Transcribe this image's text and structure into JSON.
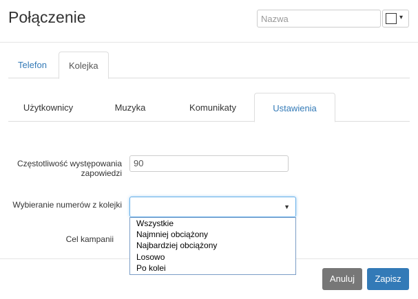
{
  "header": {
    "title": "Połączenie",
    "name_placeholder": "Nazwa",
    "color_caret": "▾"
  },
  "tabs_primary": [
    {
      "label": "Telefon",
      "active": false
    },
    {
      "label": "Kolejka",
      "active": true
    }
  ],
  "tabs_secondary": [
    {
      "label": "Użytkownicy",
      "active": false
    },
    {
      "label": "Muzyka",
      "active": false
    },
    {
      "label": "Komunikaty",
      "active": false
    },
    {
      "label": "Ustawienia",
      "active": true
    }
  ],
  "form": {
    "frequency_label_line1": "Częstotliwość występowania",
    "frequency_label_line2": "zapowiedzi",
    "frequency_value": "90",
    "dial_label": "Wybieranie numerów z kolejki",
    "dial_caret": "▼",
    "dial_selected": "",
    "dial_options": [
      "Wszystkie",
      "Najmniej obciążony",
      "Najbardziej obciążony",
      "Losowo",
      "Po kolei"
    ],
    "campaign_label": "Cel kampanii"
  },
  "footer": {
    "cancel_label": "Anuluj",
    "save_label": "Zapisz"
  },
  "colors": {
    "primary": "#337ab7",
    "cancel": "#777777",
    "link": "#337ab7"
  }
}
